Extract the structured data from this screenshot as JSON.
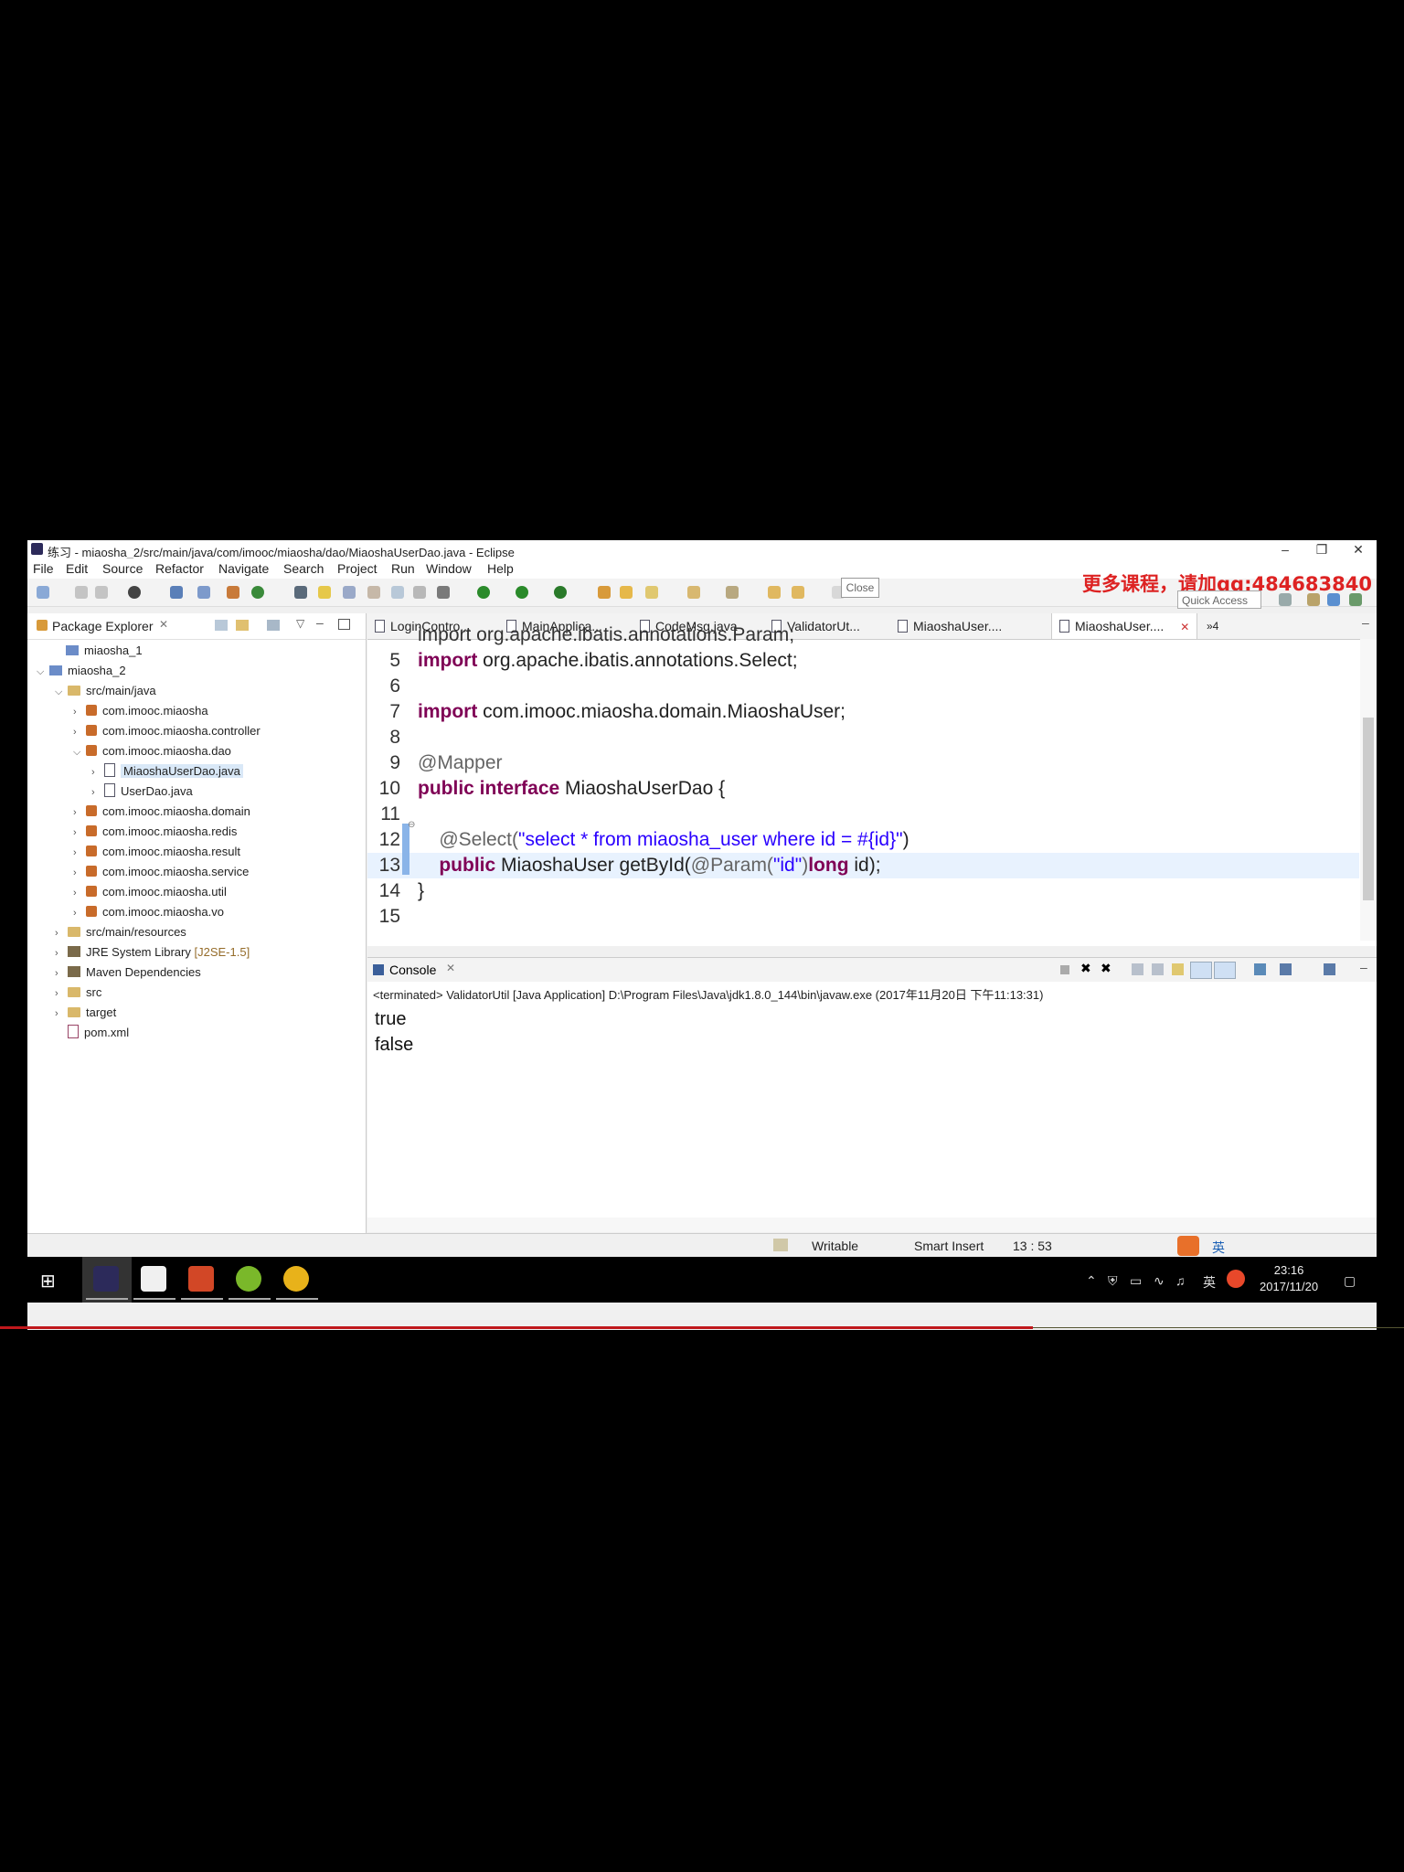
{
  "window": {
    "title": "练习 - miaosha_2/src/main/java/com/imooc/miaosha/dao/MiaoshaUserDao.java - Eclipse"
  },
  "menu": [
    "File",
    "Edit",
    "Source",
    "Refactor",
    "Navigate",
    "Search",
    "Project",
    "Run",
    "Window",
    "Help"
  ],
  "watermark": "更多课程，请加qq:484683840",
  "quick_access": "Quick Access",
  "package_explorer": {
    "title": "Package Explorer",
    "items": [
      {
        "label": "miaosha_1"
      },
      {
        "label": "miaosha_2"
      },
      {
        "label": "src/main/java"
      },
      {
        "label": "com.imooc.miaosha"
      },
      {
        "label": "com.imooc.miaosha.controller"
      },
      {
        "label": "com.imooc.miaosha.dao"
      },
      {
        "label": "MiaoshaUserDao.java"
      },
      {
        "label": "UserDao.java"
      },
      {
        "label": "com.imooc.miaosha.domain"
      },
      {
        "label": "com.imooc.miaosha.redis"
      },
      {
        "label": "com.imooc.miaosha.result"
      },
      {
        "label": "com.imooc.miaosha.service"
      },
      {
        "label": "com.imooc.miaosha.util"
      },
      {
        "label": "com.imooc.miaosha.vo"
      },
      {
        "label": "src/main/resources"
      },
      {
        "label": "JRE System Library",
        "suffix": "[J2SE-1.5]"
      },
      {
        "label": "Maven Dependencies"
      },
      {
        "label": "src"
      },
      {
        "label": "target"
      },
      {
        "label": "pom.xml"
      }
    ]
  },
  "tabs": [
    "LoginContro...",
    "MainApplica...",
    "CodeMsg.java",
    "ValidatorUt...",
    "MiaoshaUser....",
    "MiaoshaUser...."
  ],
  "tab_overflow": "»4",
  "tooltip": "Close",
  "code": {
    "partial_line": "import org.apache.ibatis.annotations.Param;",
    "lines": [
      {
        "n": "5",
        "parts": [
          {
            "t": "import",
            "c": "kw"
          },
          {
            "t": " org.apache.ibatis.annotations.Select;",
            "c": ""
          }
        ]
      },
      {
        "n": "6",
        "parts": []
      },
      {
        "n": "7",
        "parts": [
          {
            "t": "import",
            "c": "kw"
          },
          {
            "t": " com.imooc.miaosha.domain.MiaoshaUser;",
            "c": ""
          }
        ]
      },
      {
        "n": "8",
        "parts": []
      },
      {
        "n": "9",
        "parts": [
          {
            "t": "@Mapper",
            "c": "ann"
          }
        ]
      },
      {
        "n": "10",
        "parts": [
          {
            "t": "public interface",
            "c": "kw"
          },
          {
            "t": " MiaoshaUserDao {",
            "c": ""
          }
        ]
      },
      {
        "n": "11",
        "parts": []
      },
      {
        "n": "12",
        "parts": [
          {
            "t": "    @Select(",
            "c": "ann"
          },
          {
            "t": "\"select * from miaosha_user where id = #{id}\"",
            "c": "str"
          },
          {
            "t": ")",
            "c": ""
          }
        ]
      },
      {
        "n": "13",
        "parts": [
          {
            "t": "    public",
            "c": "kw"
          },
          {
            "t": " MiaoshaUser getById(",
            "c": ""
          },
          {
            "t": "@Param(",
            "c": "ann"
          },
          {
            "t": "\"id\"",
            "c": "str"
          },
          {
            "t": ")",
            "c": "ann"
          },
          {
            "t": "long",
            "c": "kw"
          },
          {
            "t": " id);",
            "c": ""
          }
        ]
      },
      {
        "n": "14",
        "parts": [
          {
            "t": "}",
            "c": ""
          }
        ]
      },
      {
        "n": "15",
        "parts": []
      }
    ]
  },
  "console": {
    "title": "Console",
    "path": "<terminated> ValidatorUtil [Java Application] D:\\Program Files\\Java\\jdk1.8.0_144\\bin\\javaw.exe (2017年11月20日 下午11:13:31)",
    "output": [
      "true",
      "false"
    ]
  },
  "status": {
    "writable": "Writable",
    "insert_mode": "Smart Insert",
    "position": "13 : 53"
  },
  "taskbar": {
    "time": "23:16",
    "date": "2017/11/20",
    "ime": "英"
  },
  "colors": {
    "keyword": "#7f0055",
    "string": "#2a00ff",
    "annotation": "#646464",
    "watermark": "#dd2222"
  }
}
